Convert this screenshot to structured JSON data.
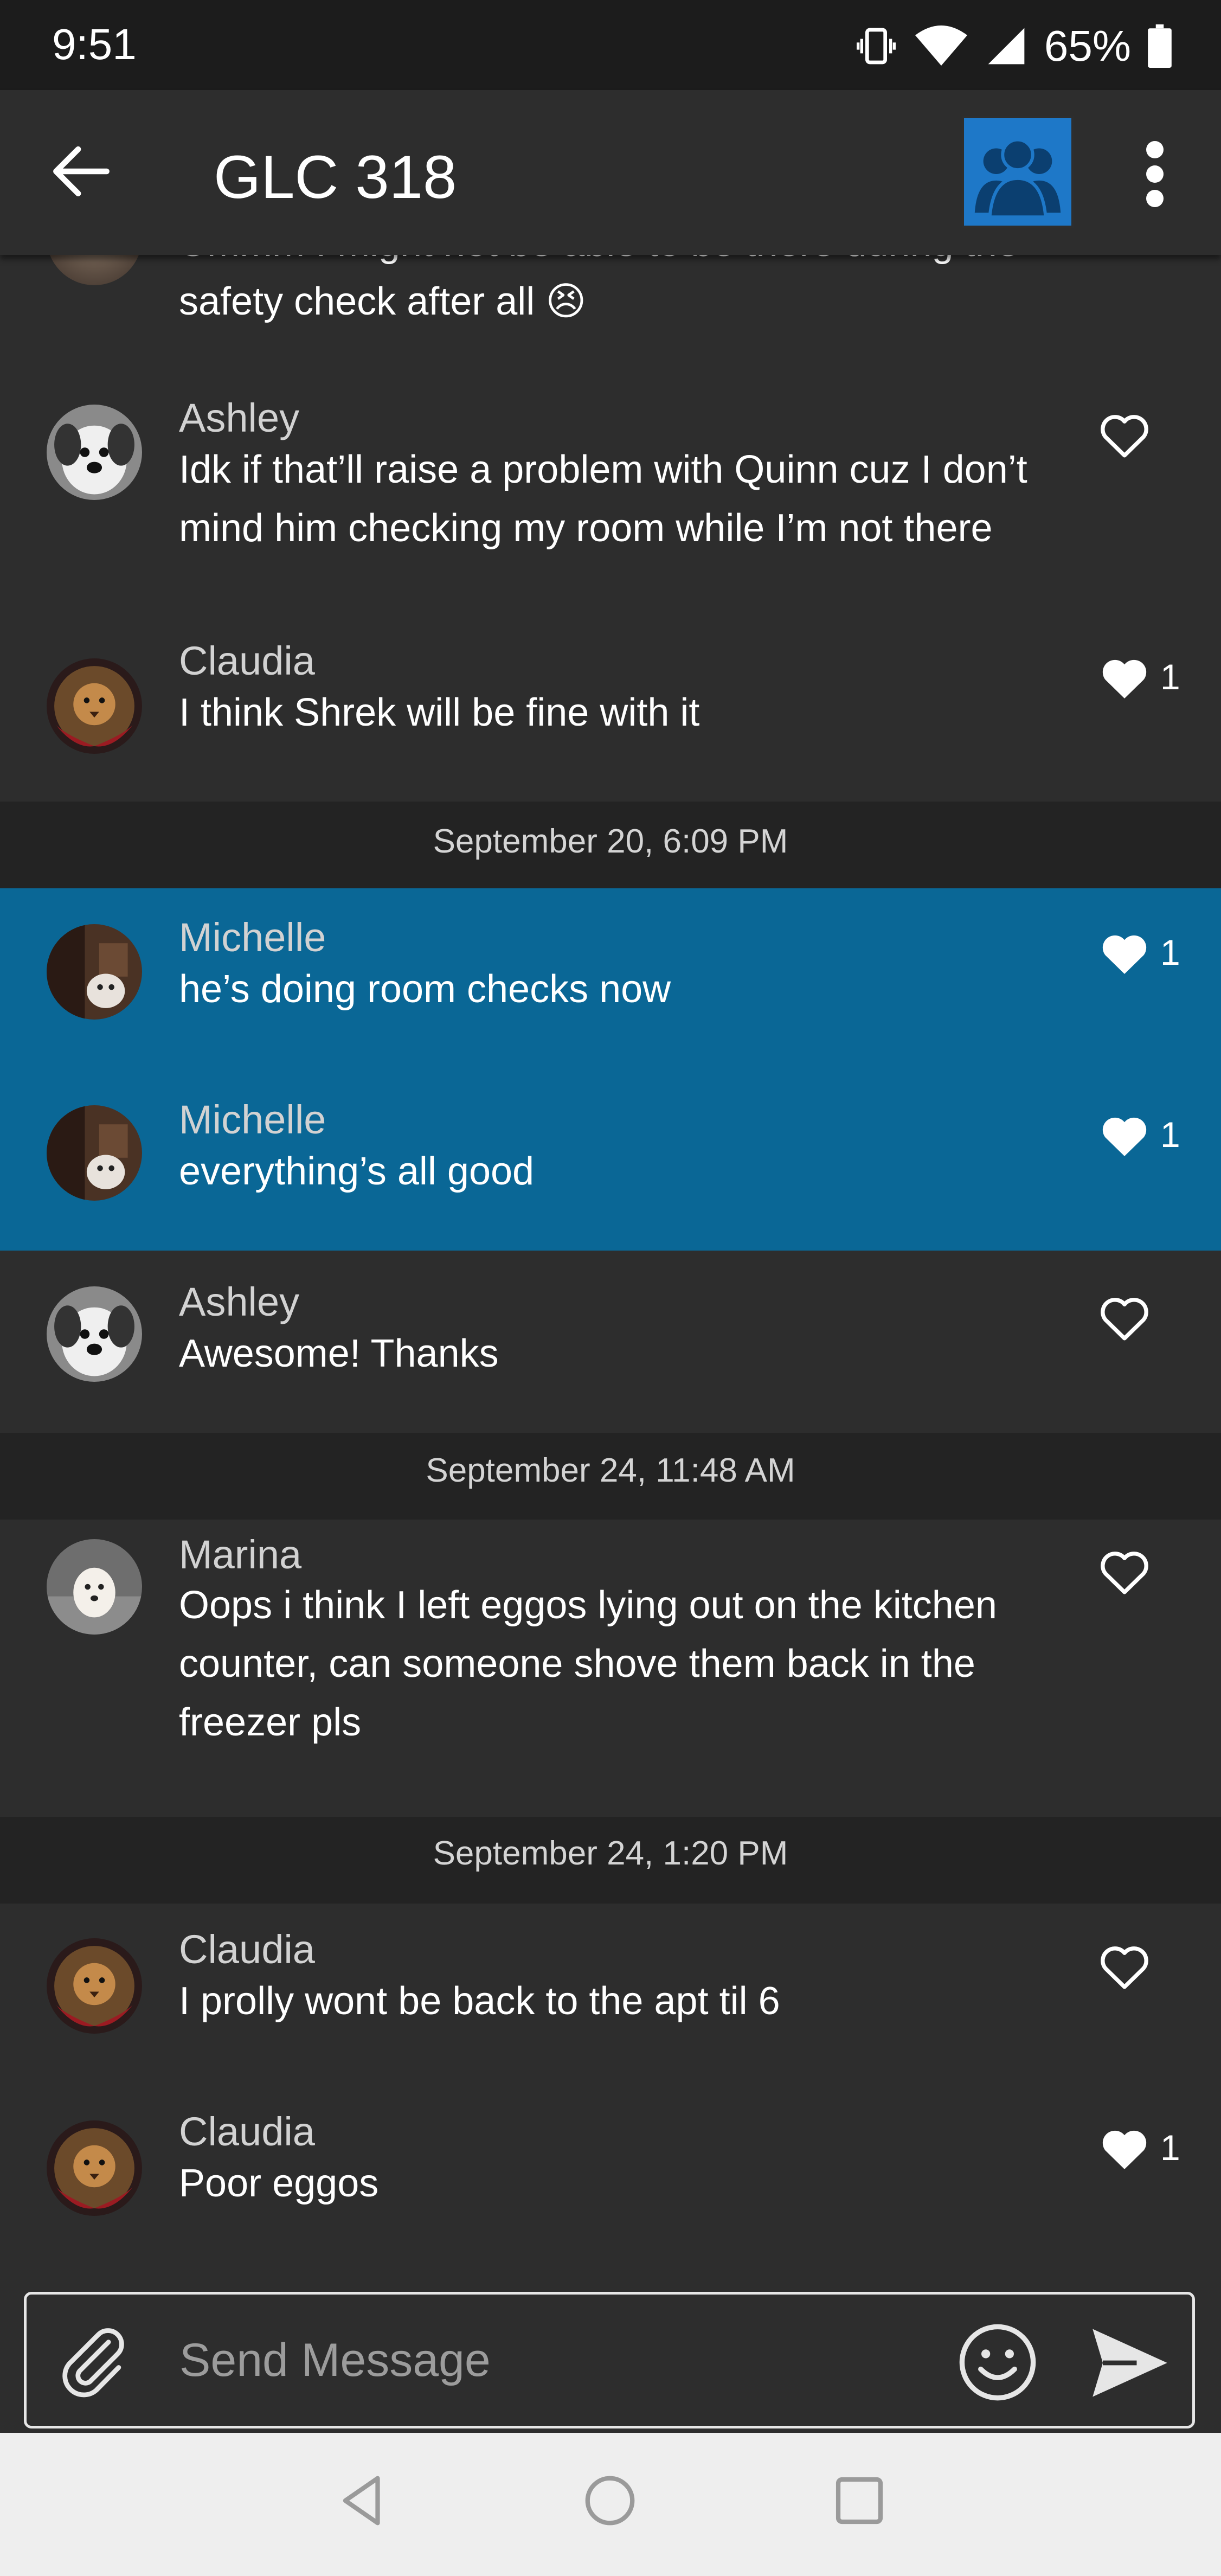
{
  "status_bar": {
    "time": "9:51",
    "battery": "65%",
    "icons": [
      "vibrate-icon",
      "wifi-icon",
      "signal-icon",
      "battery-icon"
    ]
  },
  "app_bar": {
    "title": "GLC 318",
    "back_icon": "arrow-left-icon",
    "menu_icon": "more-vert-icon",
    "group_icon": "group-avatar-icon"
  },
  "messages": [
    {
      "text": "Ummm I might not be able to be there during the safety check after all 😣"
    },
    {
      "sender": "Ashley",
      "text": "Idk if that’ll raise a problem with Quinn cuz I don’t mind him checking my room while I’m not there"
    },
    {
      "sender": "Claudia",
      "text": "I think Shrek will be fine with it",
      "likes": "1"
    },
    {
      "separator": "September 20, 6:09 PM"
    },
    {
      "sender": "Michelle",
      "text": "he’s doing room checks now",
      "likes": "1"
    },
    {
      "sender": "Michelle",
      "text": "everything’s all good",
      "likes": "1"
    },
    {
      "sender": "Ashley",
      "text": "Awesome! Thanks"
    },
    {
      "separator": "September 24, 11:48 AM"
    },
    {
      "sender": "Marina",
      "text": "Oops i think I left eggos lying out on the kitchen counter, can someone shove them back in the freezer pls"
    },
    {
      "separator": "September 24, 1:20 PM"
    },
    {
      "sender": "Claudia",
      "text": "I prolly wont be back to the apt til 6"
    },
    {
      "sender": "Claudia",
      "text": "Poor eggos",
      "likes": "1"
    }
  ],
  "compose": {
    "placeholder": "Send Message"
  },
  "colors": {
    "highlight": "#0a6796",
    "background": "#2d2d2d",
    "separator": "#232323",
    "group_avatar": "#1e78c8"
  }
}
